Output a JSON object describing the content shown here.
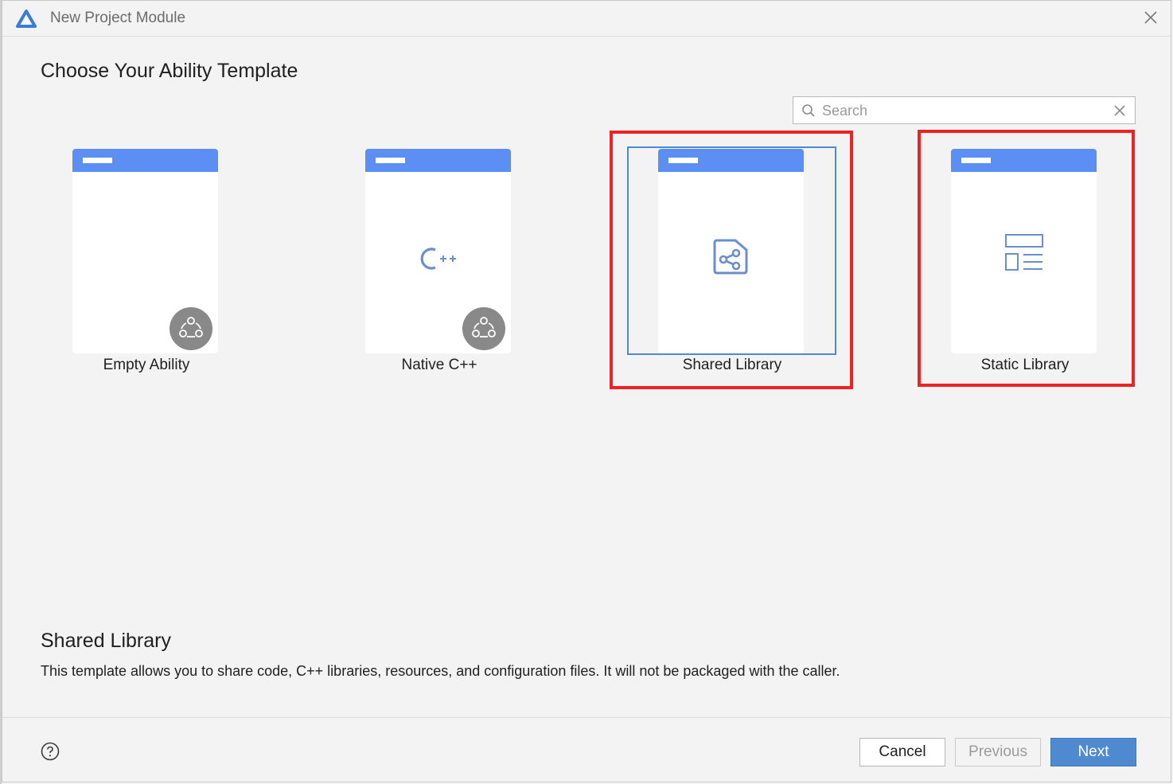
{
  "window": {
    "title": "New Project Module"
  },
  "heading": "Choose Your Ability Template",
  "search": {
    "placeholder": "Search",
    "value": ""
  },
  "templates": [
    {
      "label": "Empty Ability",
      "icon": "none",
      "badge": "atomic-service-badge-icon"
    },
    {
      "label": "Native C++",
      "icon": "cpp-icon",
      "badge": "atomic-service-badge-icon"
    },
    {
      "label": "Shared Library",
      "icon": "shared-library-icon",
      "selected": true
    },
    {
      "label": "Static Library",
      "icon": "static-library-icon"
    }
  ],
  "description": {
    "title": "Shared Library",
    "text": "This template allows you to share code, C++ libraries, resources, and configuration files. It will not be packaged with the caller."
  },
  "footer": {
    "cancel_label": "Cancel",
    "previous_label": "Previous",
    "next_label": "Next"
  },
  "colors": {
    "accent": "#4f8ad0",
    "card_header": "#5b8ff4",
    "annotation_red": "#ee2222",
    "icon_blue": "#6b8fce"
  }
}
